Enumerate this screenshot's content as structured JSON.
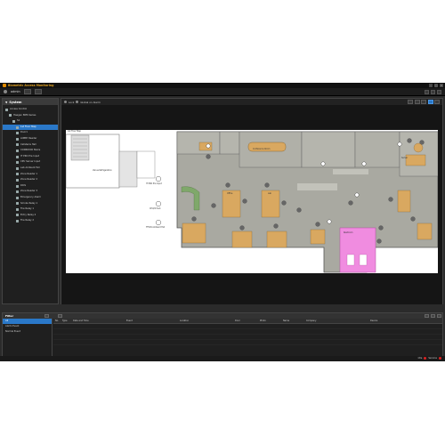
{
  "app": {
    "title": "Biometric Access Monitoring"
  },
  "user": {
    "name": "admin"
  },
  "left_panel": {
    "title": "System",
    "tree": [
      {
        "label": "Access Control",
        "indent": 0
      },
      {
        "label": "Haagen BMS Series",
        "indent": 1
      },
      {
        "label": "S1",
        "indent": 2
      },
      {
        "label": "1st Floor Map",
        "indent": 3,
        "selected": true
      },
      {
        "label": "Door1",
        "indent": 3
      },
      {
        "label": "LOBBY Reader",
        "indent": 3
      },
      {
        "label": "Cafeteria Hall",
        "indent": 3
      },
      {
        "label": "CORRIDOR Stairs",
        "indent": 3
      },
      {
        "label": "IT PRO Pre Input",
        "indent": 3
      },
      {
        "label": "CPU Server Input",
        "indent": 3
      },
      {
        "label": "Lab Ambient Fall",
        "indent": 3
      },
      {
        "label": "Zone Reader 1",
        "indent": 3
      },
      {
        "label": "Zone Reader 2",
        "indent": 3
      },
      {
        "label": "RICS",
        "indent": 3
      },
      {
        "label": "Zone Reader 3",
        "indent": 3
      },
      {
        "label": "Emergency Alarm",
        "indent": 3
      },
      {
        "label": "Smoke Relay 1",
        "indent": 3
      },
      {
        "label": "Fire Relay 1",
        "indent": 3
      },
      {
        "label": "Entry Relay 2",
        "indent": 3
      },
      {
        "label": "Fire Relay 2",
        "indent": 3
      }
    ]
  },
  "map_toolbar": {
    "lock_label": "Lock",
    "show_label": "Global on Alarm"
  },
  "map": {
    "title": "1st Floor Map",
    "labels": {
      "venue": "Venue Refrigeration",
      "door_input": "IT PRO Pre Input",
      "cpu_input": "CPU/IO Sub",
      "ambient": "TFS30 Ambient Fall",
      "conference": "Conference Room",
      "lab": "Lab",
      "office": "Office",
      "restroom": "Restroom",
      "server": "Server"
    }
  },
  "bottom_panel": {
    "title": "Filter",
    "filters": [
      {
        "label": "All",
        "selected": true
      },
      {
        "label": "Alarm Event",
        "selected": false
      },
      {
        "label": "Normal Event",
        "selected": false
      }
    ],
    "columns": [
      "No.",
      "Type",
      "Date and Time",
      "Event",
      "Location",
      "Door",
      "Photo",
      "Name",
      "Company",
      "Device"
    ]
  },
  "status": {
    "label1": "Idle",
    "label2": "Service"
  },
  "colors": {
    "accent": "#2a78c8",
    "title": "#e0a020",
    "floor": "#a8a8a0",
    "pink": "#f08ce0",
    "desk": "#d9a860"
  }
}
